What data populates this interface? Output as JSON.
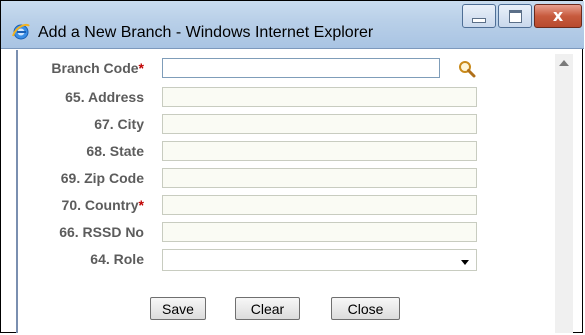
{
  "window": {
    "title": "Add a New Branch - Windows Internet Explorer",
    "close_symbol": "x"
  },
  "form": {
    "fields": [
      {
        "label": "Branch Code",
        "required": true,
        "value": ""
      },
      {
        "label": "65. Address",
        "required": false,
        "value": ""
      },
      {
        "label": "67. City",
        "required": false,
        "value": ""
      },
      {
        "label": "68. State",
        "required": false,
        "value": ""
      },
      {
        "label": "69. Zip Code",
        "required": false,
        "value": ""
      },
      {
        "label": "70. Country",
        "required": true,
        "value": ""
      },
      {
        "label": "66. RSSD No",
        "required": false,
        "value": ""
      },
      {
        "label": "64. Role",
        "required": false,
        "value": ""
      }
    ],
    "required_marker": "*"
  },
  "buttons": {
    "save": "Save",
    "clear": "Clear",
    "close": "Close"
  },
  "colors": {
    "label": "#5c5c5c",
    "required": "#c00000",
    "titlebar": "#b8cfe8"
  },
  "icons": {
    "browser": "internet-explorer-icon",
    "lookup": "magnifier-icon"
  }
}
